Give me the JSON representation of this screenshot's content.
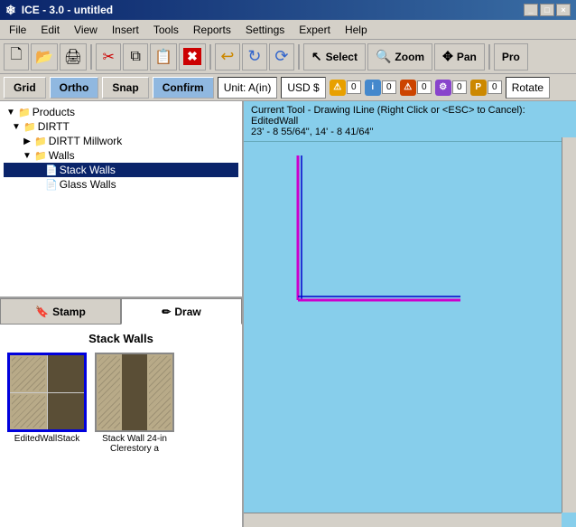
{
  "titlebar": {
    "title": "ICE - 3.0 - untitled",
    "icon": "❄"
  },
  "menubar": {
    "items": [
      "File",
      "Edit",
      "View",
      "Insert",
      "Tools",
      "Reports",
      "Settings",
      "Expert",
      "Help"
    ]
  },
  "toolbar": {
    "buttons": [
      {
        "name": "new",
        "icon": "📄"
      },
      {
        "name": "open",
        "icon": "📂"
      },
      {
        "name": "print",
        "icon": "🖨"
      },
      {
        "name": "cut",
        "icon": "✂"
      },
      {
        "name": "copy",
        "icon": "📋"
      },
      {
        "name": "paste",
        "icon": "📋"
      },
      {
        "name": "delete",
        "icon": "✖"
      },
      {
        "name": "undo",
        "icon": "↩"
      },
      {
        "name": "redo",
        "icon": "↪"
      },
      {
        "name": "refresh",
        "icon": "↻"
      }
    ],
    "select_label": "Select",
    "zoom_label": "Zoom",
    "pan_label": "Pan",
    "pro_label": "Pro"
  },
  "actionbar": {
    "grid_label": "Grid",
    "ortho_label": "Ortho",
    "snap_label": "Snap",
    "confirm_label": "Confirm",
    "unit_label": "Unit: A(in)",
    "usd_label": "USD $",
    "badges": [
      {
        "icon": "⚠",
        "color": "#e8a000",
        "num": "0"
      },
      {
        "icon": "ℹ",
        "color": "#4488cc",
        "num": "0"
      },
      {
        "icon": "⚠",
        "color": "#cc4400",
        "num": "0"
      },
      {
        "icon": "⚙",
        "color": "#8844cc",
        "num": "0"
      },
      {
        "icon": "P",
        "color": "#cc8800",
        "num": "0"
      }
    ],
    "rotate_label": "Rotate"
  },
  "tree": {
    "items": [
      {
        "label": "Products",
        "level": 0,
        "expand": "▼",
        "icon": "📁"
      },
      {
        "label": "DIRTT",
        "level": 1,
        "expand": "▼",
        "icon": "📁"
      },
      {
        "label": "DIRTT Millwork",
        "level": 2,
        "expand": "▶",
        "icon": "📁"
      },
      {
        "label": "Walls",
        "level": 2,
        "expand": "▼",
        "icon": "📁"
      },
      {
        "label": "Stack Walls",
        "level": 3,
        "expand": "",
        "icon": "📄",
        "selected": true
      },
      {
        "label": "Glass Walls",
        "level": 3,
        "expand": "",
        "icon": "📄"
      }
    ]
  },
  "panel_tabs": {
    "stamp_label": "Stamp",
    "draw_label": "Draw"
  },
  "products": {
    "category_title": "Stack Walls",
    "items": [
      {
        "name": "EditedWallStack",
        "selected": true,
        "pattern": "quad"
      },
      {
        "name": "Stack Wall 24-in Clerestory a",
        "selected": false,
        "pattern": "dual"
      }
    ]
  },
  "status": {
    "current_tool": "Current Tool - Drawing ILine (Right Click or <ESC> to Cancel): EditedWall",
    "coordinates": "23' - 8 55/64\", 14' - 8 41/64\""
  }
}
